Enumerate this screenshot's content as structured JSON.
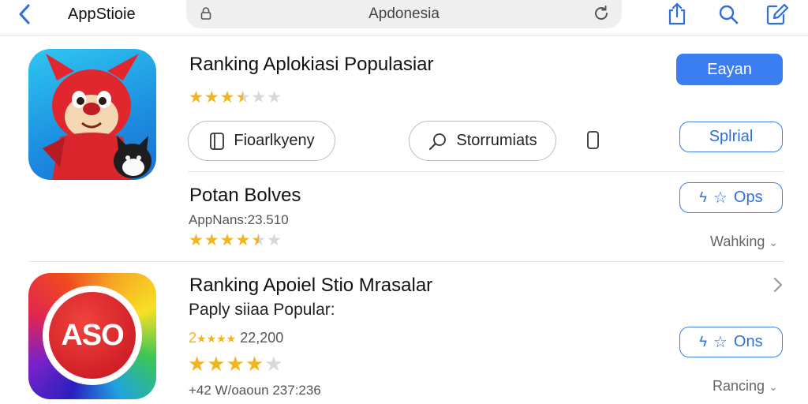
{
  "header": {
    "app_name": "AppStioie",
    "url": "Apdonesia"
  },
  "items": [
    {
      "title": "Ranking Aplokiasi Populasiar",
      "stars": 3.5,
      "primary_button": "Eayan",
      "pill_one": "Fioarlkyeny",
      "pill_two": "Storrumiats",
      "outline_button": "Splrial"
    },
    {
      "title": "Potan Bolves",
      "meta": "AppNans:23.510",
      "stars": 4.5,
      "outline_button": "Ops",
      "sort_label": "Wahking"
    },
    {
      "title": "Ranking Apoiel Stio Mrasalar",
      "subtitle": "Paply siiaa Popular:",
      "rating_line": "22,200",
      "rating_prefix": "2",
      "stars": 4,
      "meta": "+42 W/oaoun 237:236",
      "outline_button": "Ons",
      "sort_label": "Rancing",
      "logo_text": "ASO"
    }
  ],
  "colors": {
    "accent": "#3b7ef2",
    "star": "#f2b51d"
  }
}
